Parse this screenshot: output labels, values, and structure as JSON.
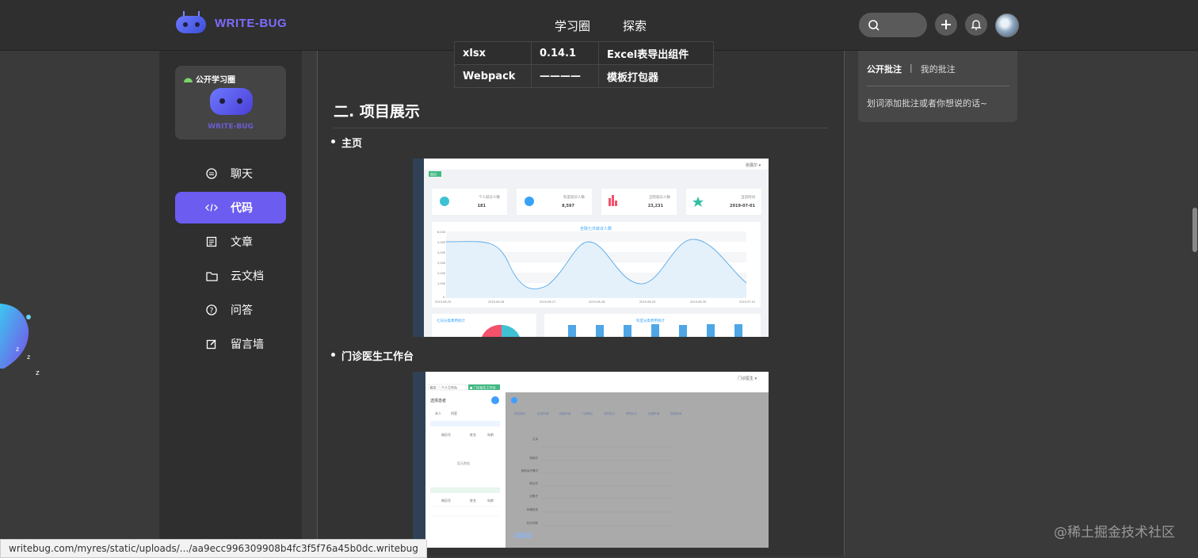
{
  "header": {
    "logo_text": "WRITE-BUG",
    "nav": [
      "学习圈",
      "探索"
    ]
  },
  "sidebar": {
    "circle_tag": "公开学习圈",
    "circle_logo_text": "WRITE-BUG",
    "items": [
      {
        "label": "聊天",
        "icon": "chat-icon",
        "active": false
      },
      {
        "label": "代码",
        "icon": "code-icon",
        "active": true
      },
      {
        "label": "文章",
        "icon": "article-icon",
        "active": false
      },
      {
        "label": "云文档",
        "icon": "folder-icon",
        "active": false
      },
      {
        "label": "问答",
        "icon": "question-icon",
        "active": false
      },
      {
        "label": "留言墙",
        "icon": "edit-icon",
        "active": false
      }
    ],
    "accent_color": "#6c5cf0"
  },
  "content": {
    "table_rows": [
      [
        "xlsx",
        "0.14.1",
        "Excel表导出组件"
      ],
      [
        "Webpack",
        "————",
        "模板打包器"
      ]
    ],
    "section_title": "二. 项目展示",
    "bullets": [
      "主页",
      "门诊医生工作台"
    ],
    "screenshot1": {
      "topbar_user": "张展尔 ▾",
      "tab_label": "首页",
      "stats": [
        {
          "label": "个人就诊人数",
          "value": "181",
          "color": "#3ec1d3"
        },
        {
          "label": "科室就诊人数",
          "value": "8,597",
          "color": "#36a3f7"
        },
        {
          "label": "全院就诊人数",
          "value": "23,231",
          "color": "#f4516c"
        },
        {
          "label": "当前时间",
          "value": "2019-07-01",
          "color": "#34bfa3"
        }
      ],
      "line_title": "全院七日就诊人数",
      "y_ticks": [
        "6,000",
        "5,000",
        "4,000",
        "3,000",
        "2,000",
        "1,000",
        "0"
      ],
      "x_ticks": [
        "2019-06-25",
        "2019-06-26",
        "2019-06-27",
        "2019-06-28",
        "2019-06-29",
        "2019-06-30",
        "2019-07-01"
      ],
      "pie_title": "七日分类费用统计",
      "bar_title": "科室分类费用统计"
    },
    "screenshot2": {
      "topbar_user": "门诊医生 ▾",
      "tabs": [
        "首页",
        "个人工作台",
        "● 门诊医生工作台"
      ],
      "list_title": "选择患者",
      "list_tabs": [
        "本人",
        "科室"
      ],
      "list_empty": "暂无数据",
      "list_cols": [
        "病历号",
        "姓名",
        "年龄"
      ],
      "form_tabs": [
        "病历首页",
        "检查申请",
        "检验申请",
        "门诊确诊",
        "成药处方",
        "草药处方",
        "处置申请",
        "费用查询"
      ],
      "form_fields": [
        "主诉",
        "现病史",
        "现病治疗情况",
        "既往史",
        "过敏史",
        "体格检查",
        "初步诊断"
      ]
    }
  },
  "annotation": {
    "tabs": [
      "公开批注",
      "我的批注"
    ],
    "hint": "划词添加批注或者你想说的话~"
  },
  "status_url": "writebug.com/myres/static/uploads/.../aa9ecc996309908b4fc3f5f76a45b0dc.writebug",
  "watermark": "@稀土掘金技术社区"
}
